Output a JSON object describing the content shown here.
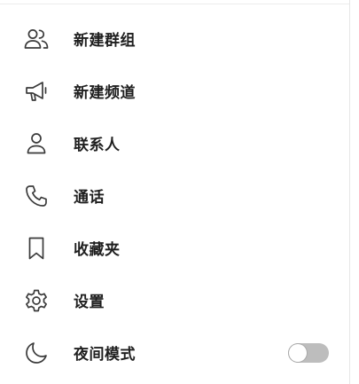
{
  "menu": {
    "items": [
      {
        "label": "新建群组",
        "icon": "group-icon"
      },
      {
        "label": "新建频道",
        "icon": "megaphone-icon"
      },
      {
        "label": "联系人",
        "icon": "person-icon"
      },
      {
        "label": "通话",
        "icon": "phone-icon"
      },
      {
        "label": "收藏夹",
        "icon": "bookmark-icon"
      },
      {
        "label": "设置",
        "icon": "gear-icon"
      },
      {
        "label": "夜间模式",
        "icon": "moon-icon"
      }
    ],
    "night_mode_enabled": false
  },
  "colors": {
    "icon_stroke": "#3a3a3a",
    "label_text": "#1f1f1f",
    "toggle_track_off": "#bdbdbd",
    "background": "#ffffff"
  }
}
